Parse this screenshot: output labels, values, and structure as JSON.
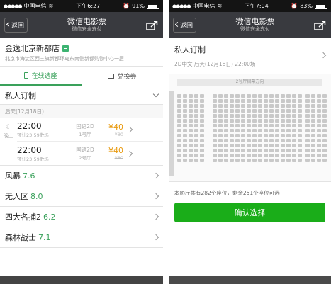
{
  "left": {
    "status": {
      "carrier": "中国电信",
      "time": "下午6:27",
      "battery_text": "91%",
      "battery_level": 0.91
    },
    "nav": {
      "back": "返回",
      "title": "微信电影票",
      "subtitle": "微信安全支付"
    },
    "cinema": {
      "name": "金逸北京新都店",
      "address": "北京市海淀区西三旗新都环岛东南侧新都购物中心一层"
    },
    "tabs": [
      {
        "label": "在线选座",
        "active": true
      },
      {
        "label": "兑换券",
        "active": false
      }
    ],
    "movie_title": "私人订制",
    "date": "后天(12月18日)",
    "period_label": "晚上",
    "showtimes": [
      {
        "time": "22:00",
        "end": "预计23:59散场",
        "version": "国语2D",
        "hall": "1号厅",
        "price": "¥40",
        "original": "¥80"
      },
      {
        "time": "22:00",
        "end": "预计23:59散场",
        "version": "国语2D",
        "hall": "2号厅",
        "price": "¥40",
        "original": "¥80"
      }
    ],
    "movies": [
      {
        "name": "风暴",
        "score": "7.6"
      },
      {
        "name": "无人区",
        "score": "8.0"
      },
      {
        "name": "四大名捕2",
        "score": "6.2"
      },
      {
        "name": "森林战士",
        "score": "7.1"
      }
    ]
  },
  "right": {
    "status": {
      "carrier": "中国电信",
      "time": "下午7:04",
      "battery_text": "83%",
      "battery_level": 0.83
    },
    "nav": {
      "back": "返回",
      "title": "微信电影票",
      "subtitle": "微信安全支付"
    },
    "movie_title": "私人订制",
    "session": "2D中文 后天(12月18日) 22:00场",
    "screen_label": "2号厅银幕方向",
    "seat_info": "本影厅共有282个座位，剩余251个座位可选",
    "confirm": "确认选择"
  },
  "colors": {
    "accent_green": "#1aad19",
    "price_orange": "#e89a0f",
    "navbar": "#393a3f"
  }
}
